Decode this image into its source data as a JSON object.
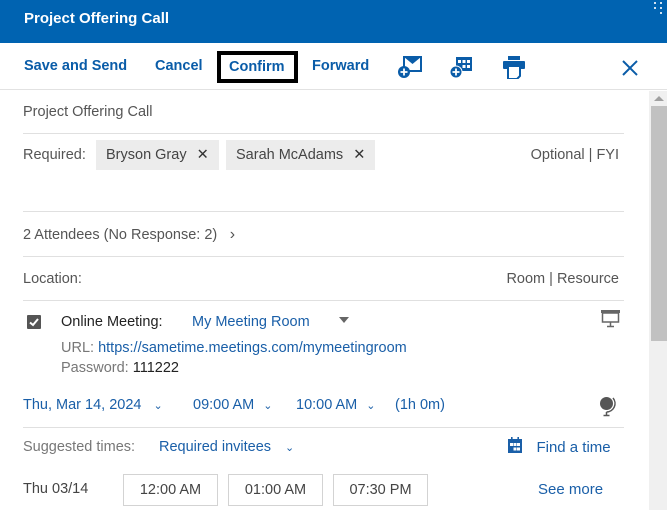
{
  "window": {
    "title": "Project Offering Call"
  },
  "toolbar": {
    "save_and_send": "Save and Send",
    "cancel": "Cancel",
    "confirm": "Confirm",
    "forward": "Forward",
    "icons": [
      "new-message-icon",
      "new-calendar-entry-icon",
      "print-icon",
      "close-icon"
    ]
  },
  "form": {
    "subject": "Project Offering Call",
    "required_label": "Required:",
    "attendees": [
      {
        "name": "Bryson Gray",
        "remove": "✕"
      },
      {
        "name": "Sarah McAdams",
        "remove": "✕"
      }
    ],
    "optional_fyi": "Optional | FYI",
    "attendee_summary": "2 Attendees (No Response: 2)",
    "attendee_chevron": "›",
    "location_label": "Location:",
    "room_resource": "Room | Resource",
    "online_meeting": {
      "checked": true,
      "label": "Online Meeting:",
      "room": "My Meeting Room",
      "url_label": "URL:",
      "url": "https://sametime.meetings.com/mymeetingroom",
      "password_label": "Password:",
      "password": "111222"
    },
    "date": "Thu, Mar 14, 2024",
    "start_time": "09:00 AM",
    "end_time": "10:00 AM",
    "duration": "(1h 0m)",
    "suggested_label": "Suggested times:",
    "suggested_filter": "Required invitees",
    "find_a_time": "Find a time",
    "suggestion_day": "Thu 03/14",
    "suggested_times": [
      "12:00 AM",
      "01:00 AM",
      "07:30 PM"
    ],
    "see_more": "See more"
  },
  "colors": {
    "titlebar": "#0063b1",
    "link": "#1a5fa8",
    "toolbar_text": "#0a5ca8",
    "chip_bg": "#ececec"
  }
}
